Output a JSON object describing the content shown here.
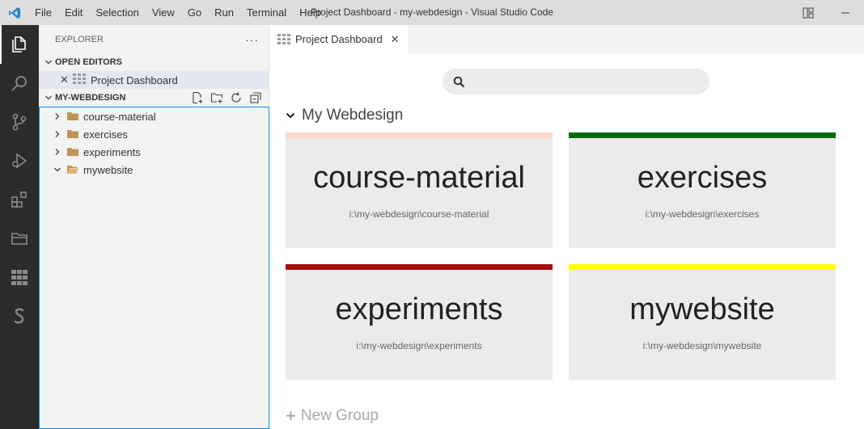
{
  "titlebar": {
    "menu": [
      "File",
      "Edit",
      "Selection",
      "View",
      "Go",
      "Run",
      "Terminal",
      "Help"
    ],
    "window_title": "Project Dashboard - my-webdesign - Visual Studio Code"
  },
  "sidebar": {
    "title": "EXPLORER",
    "more": "···",
    "open_editors_label": "OPEN EDITORS",
    "open_editor_item": "Project Dashboard",
    "workspace_label": "MY-WEBDESIGN",
    "tree": [
      {
        "label": "course-material",
        "expanded": false
      },
      {
        "label": "exercises",
        "expanded": false
      },
      {
        "label": "experiments",
        "expanded": false
      },
      {
        "label": "mywebsite",
        "expanded": true
      }
    ]
  },
  "editor": {
    "tab_label": "Project Dashboard",
    "search_placeholder": "",
    "group_name": "My Webdesign",
    "projects": [
      {
        "name": "course-material",
        "path": "i:\\my-webdesign\\course-material",
        "color": "#ffd8c8"
      },
      {
        "name": "exercises",
        "path": "i:\\my-webdesign\\exercises",
        "color": "#0a6b0a"
      },
      {
        "name": "experiments",
        "path": "i:\\my-webdesign\\experiments",
        "color": "#a50f0f"
      },
      {
        "name": "mywebsite",
        "path": "i:\\my-webdesign\\mywebsite",
        "color": "#ffff00"
      }
    ],
    "new_group_label": "New Group"
  },
  "colors": {
    "accent": "#0090f1",
    "activity_bar": "#2c2c2c",
    "folder": "#c09553"
  }
}
